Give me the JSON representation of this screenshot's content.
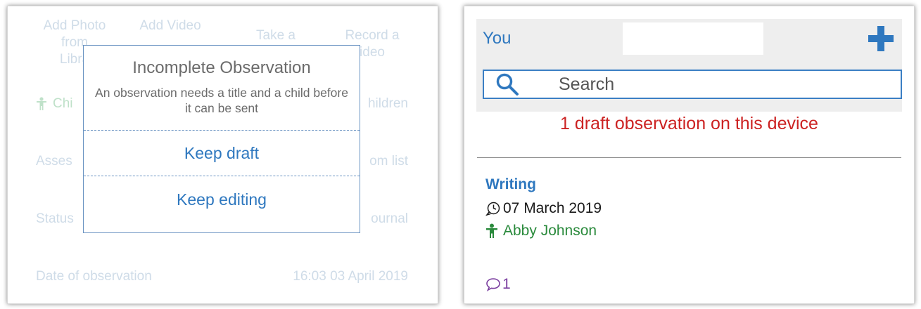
{
  "left_panel": {
    "media_actions": [
      {
        "label": "Add Photo from Library",
        "visible": "Add Photo\nfrom\nLibra"
      },
      {
        "label": "Add Video",
        "visible": "Add Video"
      },
      {
        "label": "Take a",
        "visible": "Take a"
      },
      {
        "label": "Record a Video",
        "visible": "Record a\nideo"
      }
    ],
    "children_row": {
      "label": "Chi",
      "value": "hildren"
    },
    "assessment_row": {
      "label": "Asses",
      "value": "om list"
    },
    "status_row": {
      "label": "Status",
      "value": "ournal"
    },
    "date_row": {
      "label": "Date of observation",
      "value": "16:03 03 April 2019"
    },
    "dialog": {
      "title": "Incomplete Observation",
      "message": "An observation needs a title and a child before it can be sent",
      "keep_draft": "Keep draft",
      "keep_editing": "Keep editing"
    }
  },
  "right_panel": {
    "header": {
      "you_label": "You",
      "add_icon": "plus-icon"
    },
    "search": {
      "placeholder": "Search",
      "icon": "search-icon"
    },
    "draft_notice": "1 draft observation on this device",
    "observation": {
      "title": "Writing",
      "date": "07 March 2019",
      "child": "Abby Johnson",
      "comment_count": "1"
    },
    "colors": {
      "accent": "#2f78bf",
      "draft_red": "#cc2222",
      "child_green": "#2a8a3c",
      "comment_purple": "#7b3fa0"
    }
  }
}
